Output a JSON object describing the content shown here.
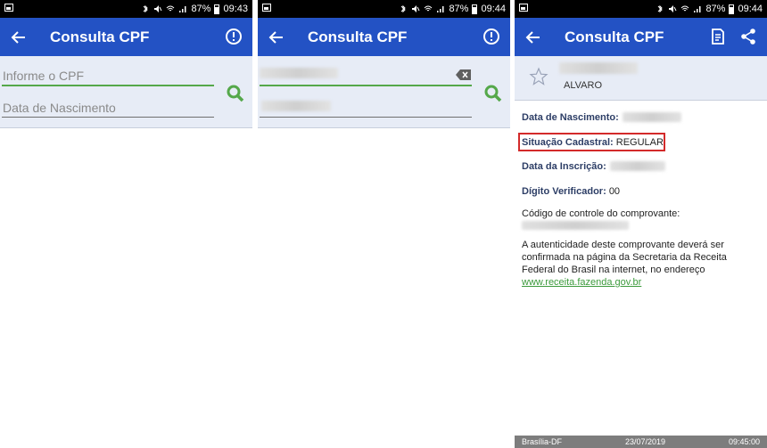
{
  "status_bars": [
    {
      "battery": "87%",
      "time": "09:43"
    },
    {
      "battery": "87%",
      "time": "09:44"
    },
    {
      "battery": "87%",
      "time": "09:44"
    }
  ],
  "app": {
    "title": "Consulta CPF"
  },
  "screen1": {
    "cpf_placeholder": "Informe o CPF",
    "birth_placeholder": "Data de Nascimento"
  },
  "screen3": {
    "name": "ALVARO",
    "birth_label": "Data de Nascimento:",
    "situation_label": "Situação Cadastral:",
    "situation_value": "REGULAR",
    "registration_label": "Data da Inscrição:",
    "check_digit_label": "Dígito Verificador:",
    "check_digit_value": "00",
    "control_code_label": "Código de controle do comprovante:",
    "notice": "A autenticidade deste comprovante deverá ser confirmada na página da Secretaria da Receita Federal do Brasil na internet, no endereço",
    "link": "www.receita.fazenda.gov.br",
    "footer": {
      "place": "Brasília-DF",
      "date": "23/07/2019",
      "time": "09:45:00"
    }
  },
  "colors": {
    "appbar": "#2352c4",
    "accent_green": "#55a84a",
    "form_bg": "#e7ecf6",
    "label_blue": "#2d3e66",
    "highlight_red": "#d32a2a"
  }
}
